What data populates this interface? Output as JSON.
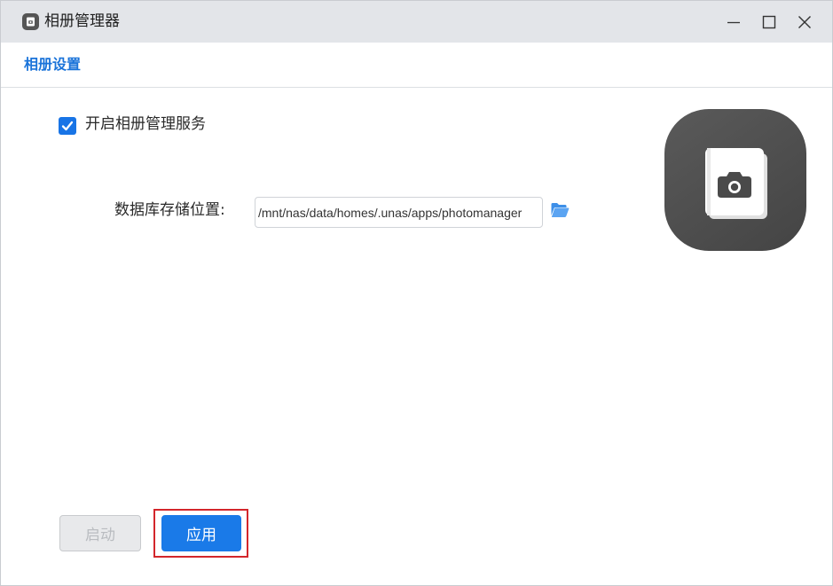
{
  "window": {
    "title": "相册管理器"
  },
  "section": {
    "title": "相册设置"
  },
  "settings": {
    "enable_label": "开启相册管理服务",
    "enable_checked": true,
    "db_location_label": "数据库存储位置:",
    "db_location_value": "/mnt/nas/data/homes/.unas/apps/photomanager"
  },
  "buttons": {
    "start_label": "启动",
    "apply_label": "应用"
  },
  "icons": {
    "app": "photo-album-icon",
    "folder": "folder-open-icon",
    "minimize": "minimize-icon",
    "maximize": "maximize-icon",
    "close": "close-icon"
  },
  "colors": {
    "accent": "#1a7ae8",
    "title_blue": "#1a73d9",
    "highlight": "#d3262b"
  }
}
